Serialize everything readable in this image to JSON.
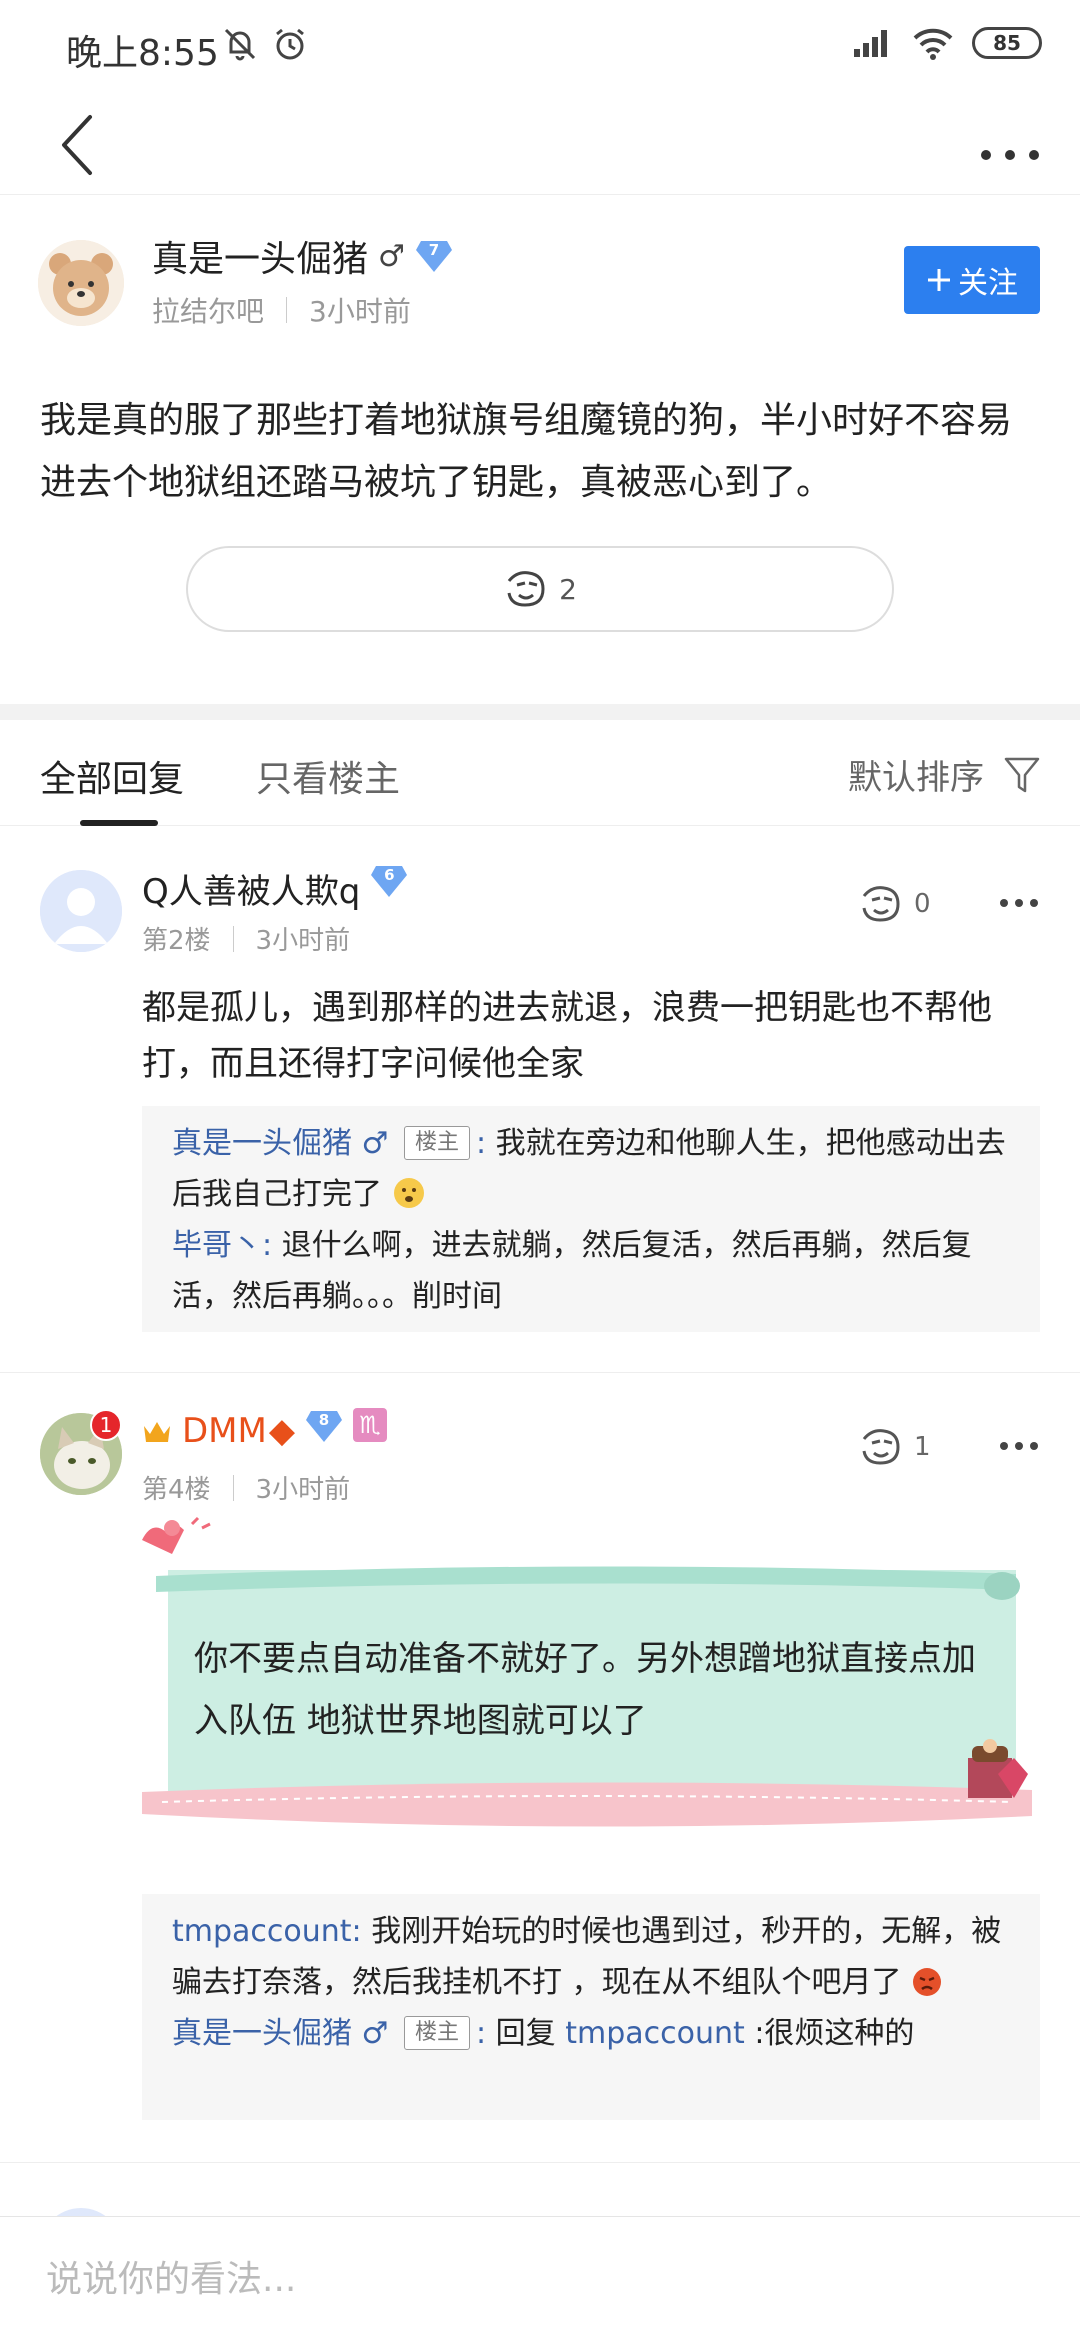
{
  "status_bar": {
    "time": "晚上8:55",
    "battery": "85"
  },
  "post": {
    "author": "真是一头倔猪",
    "gender": "♂",
    "level": "7",
    "forum": "拉结尔吧",
    "time": "3小时前",
    "follow_label": "关注",
    "body": "我是真的服了那些打着地狱旗号组魔镜的狗，半小时好不容易进去个地狱组还踏马被坑了钥匙，真被恶心到了。",
    "like_count": "2"
  },
  "tabs": {
    "all": "全部回复",
    "owner_only": "只看楼主",
    "sort": "默认排序"
  },
  "replies": [
    {
      "name": "Q人善被人欺q",
      "level": "6",
      "floor": "第2楼",
      "time": "3小时前",
      "likes": "0",
      "text": "都是孤儿，遇到那样的进去就退，浪费一把钥匙也不帮他打，而且还得打字问候他全家",
      "sub": [
        {
          "name": "真是一头倔猪",
          "gender": "♂",
          "tag": "楼主",
          "colon": ":",
          "text": "我就在旁边和他聊人生，把他感动出去后我自己打完了"
        },
        {
          "name": "毕哥丶",
          "colon": ":",
          "text": "退什么啊，进去就躺，然后复活，然后再躺，然后复活，然后再躺。。。削时间"
        }
      ]
    },
    {
      "name": "DMM",
      "diamond": "◆",
      "level": "8",
      "zodiac": "♏",
      "notif": "1",
      "floor": "第4楼",
      "time": "3小时前",
      "likes": "1",
      "card_text": "你不要点自动准备不就好了。另外想蹭地狱直接点加入队伍 地狱世界地图就可以了",
      "sub": [
        {
          "name": "tmpaccount",
          "colon": ":",
          "text": "我刚开始玩的时候也遇到过，秒开的，无解，被骗去打奈落，然后我挂机不打 ，现在从不组队个吧月了"
        },
        {
          "name": "真是一头倔猪",
          "gender": "♂",
          "tag": "楼主",
          "colon": ":",
          "reply_word": "回复",
          "reply_to": "tmpaccount",
          "text": ":很烦这种的"
        }
      ]
    }
  ],
  "input": {
    "placeholder": "说说你的看法..."
  },
  "colors": {
    "accent": "#2c7fef",
    "link": "#3a62a8",
    "dmm_name": "#e8501a"
  }
}
